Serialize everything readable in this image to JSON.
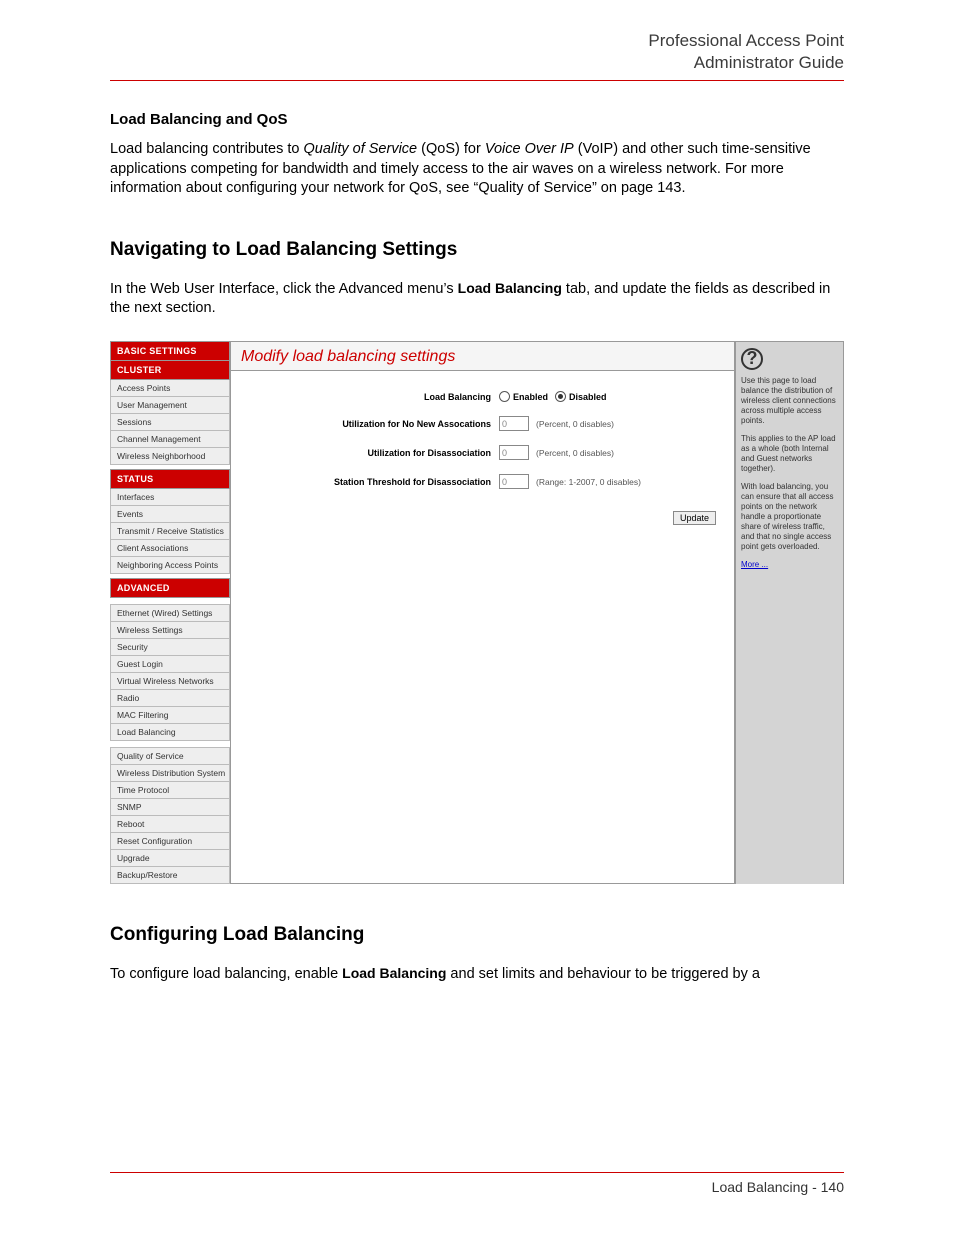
{
  "header": {
    "line1": "Professional Access Point",
    "line2": "Administrator Guide"
  },
  "section_title": "Load Balancing and QoS",
  "para1_pre": "Load balancing contributes to ",
  "para1_i1": "Quality of Service",
  "para1_mid1": " (QoS) for ",
  "para1_i2": "Voice Over IP",
  "para1_mid2": " (VoIP) and other such time-sensitive applications competing for bandwidth and timely access to the air waves on a wireless network. For more information about configuring your network for QoS, see “Quality of Service” on page 143.",
  "h2_a": "Navigating to Load Balancing Settings",
  "para2_pre": "In the Web User Interface, click the Advanced menu’s ",
  "para2_bold": "Load Balancing",
  "para2_post": " tab, and update the fields as described in the next section.",
  "h2_b": "Configuring Load Balancing",
  "para3_pre": "To configure load balancing, enable ",
  "para3_bold": "Load Balancing",
  "para3_post": " and set limits and behaviour to be triggered by a",
  "footer": "Load Balancing - 140",
  "ui": {
    "nav": {
      "basic": "BASIC SETTINGS",
      "cluster": "CLUSTER",
      "cluster_items": [
        "Access Points",
        "User Management",
        "Sessions",
        "Channel Management",
        "Wireless Neighborhood"
      ],
      "status": "STATUS",
      "status_items": [
        "Interfaces",
        "Events",
        "Transmit / Receive Statistics",
        "Client Associations",
        "Neighboring Access Points"
      ],
      "advanced": "ADVANCED",
      "advanced_items_a": [
        "Ethernet (Wired) Settings",
        "Wireless Settings",
        "Security",
        "Guest Login",
        "Virtual Wireless Networks",
        "Radio",
        "MAC Filtering",
        "Load Balancing"
      ],
      "advanced_items_b": [
        "Quality of Service",
        "Wireless Distribution System",
        "Time Protocol",
        "SNMP",
        "Reboot",
        "Reset Configuration",
        "Upgrade",
        "Backup/Restore"
      ]
    },
    "main": {
      "title": "Modify load balancing settings",
      "rows": {
        "lb_label": "Load Balancing",
        "enabled": "Enabled",
        "disabled": "Disabled",
        "util_no_new": "Utilization for No New Assocations",
        "util_dis": "Utilization for Disassociation",
        "station_thresh": "Station Threshold for Disassociation",
        "hint_pct": "(Percent, 0 disables)",
        "hint_range": "(Range: 1-2007, 0 disables)",
        "val0": "0"
      },
      "update": "Update"
    },
    "help": {
      "q": "?",
      "p1": "Use this page to load balance the distribution of wireless client connections across multiple access points.",
      "p2": "This applies to the AP load as a whole (both Internal and Guest networks together).",
      "p3": "With load balancing, you can ensure that all access points on the network handle a proportionate share of wireless traffic, and that no single access point gets overloaded.",
      "more": "More ..."
    }
  }
}
